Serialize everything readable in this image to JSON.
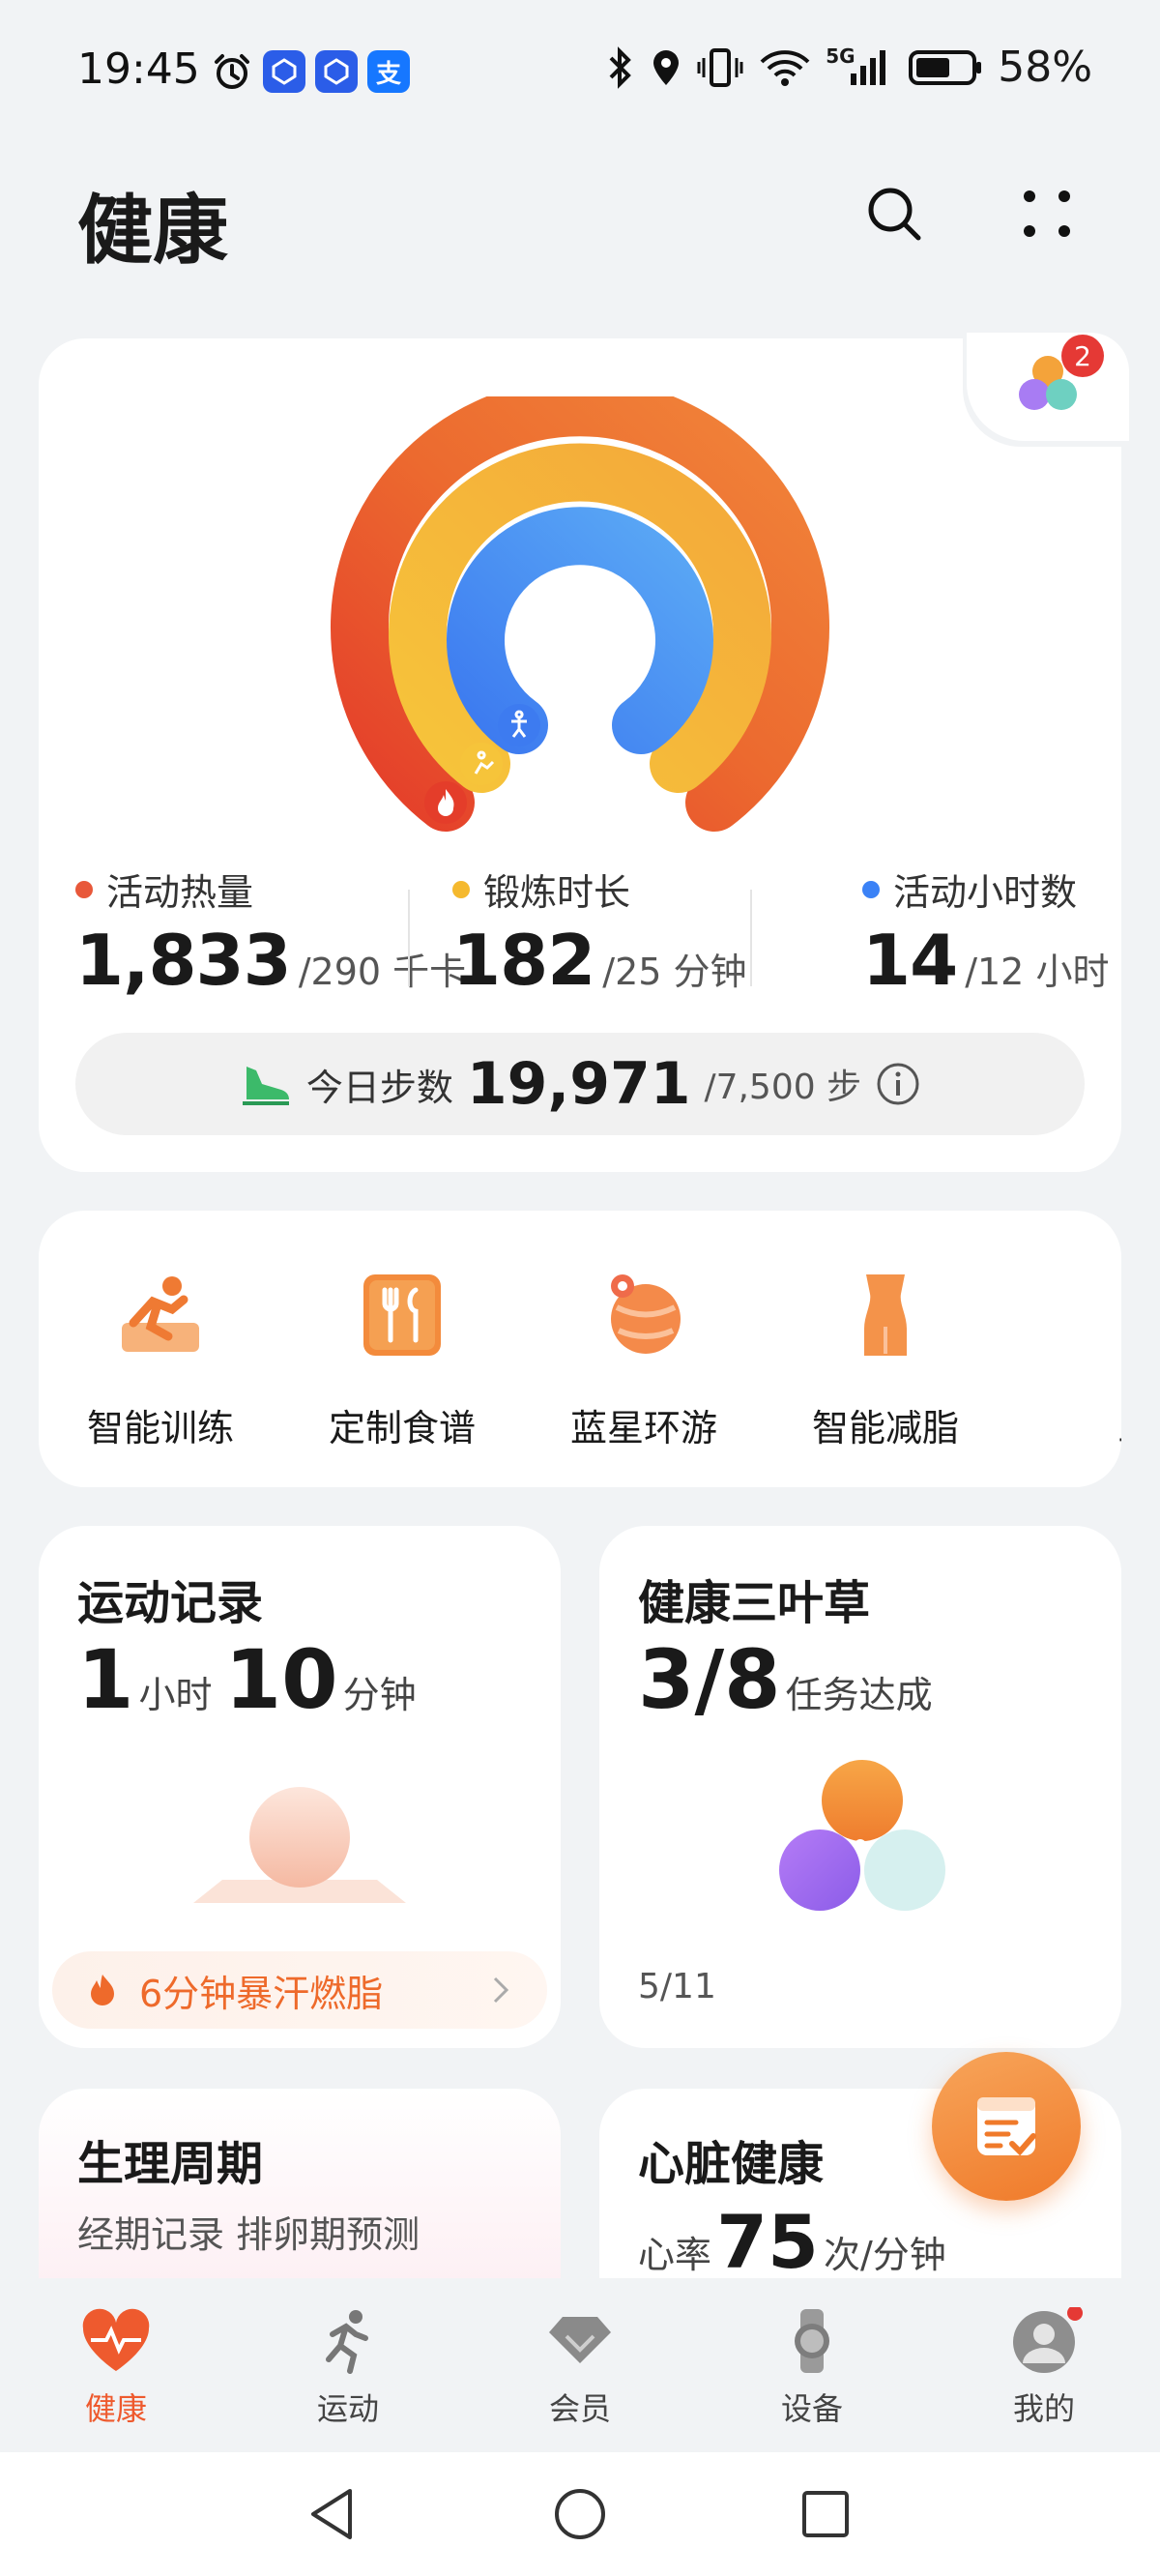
{
  "status": {
    "time": "19:45",
    "apps": [
      "alarm-icon",
      "app-icon",
      "app-icon",
      "支"
    ],
    "network": "5G",
    "battery": "58%"
  },
  "header": {
    "title": "健康"
  },
  "badge_count": "2",
  "rings": {
    "stats": [
      {
        "label": "活动热量",
        "value": "1,833",
        "target": "/290 千卡",
        "color": "#e8583a"
      },
      {
        "label": "锻炼时长",
        "value": "182",
        "target": "/25 分钟",
        "color": "#f5b92e"
      },
      {
        "label": "活动小时数",
        "value": "14",
        "target": "/12 小时",
        "color": "#3b82f6"
      }
    ],
    "steps": {
      "label": "今日步数",
      "value": "19,971",
      "target": "/7,500 步"
    }
  },
  "services": [
    {
      "label": "智能训练"
    },
    {
      "label": "定制食谱"
    },
    {
      "label": "蓝星环游"
    },
    {
      "label": "智能减脂"
    },
    {
      "label": "三环"
    }
  ],
  "exercise": {
    "title": "运动记录",
    "hours": "1",
    "hours_unit": "小时",
    "minutes": "10",
    "minutes_unit": "分钟",
    "promo": "6分钟暴汗燃脂"
  },
  "clover": {
    "title": "健康三叶草",
    "value": "3/8",
    "unit": "任务达成",
    "date": "5/11"
  },
  "period": {
    "title": "生理周期",
    "subtitle": "经期记录 排卵期预测"
  },
  "heart": {
    "title": "心脏健康",
    "label": "心率",
    "value": "75",
    "unit": "次/分钟"
  },
  "nav": [
    {
      "label": "健康",
      "active": true
    },
    {
      "label": "运动"
    },
    {
      "label": "会员"
    },
    {
      "label": "设备"
    },
    {
      "label": "我的"
    }
  ]
}
